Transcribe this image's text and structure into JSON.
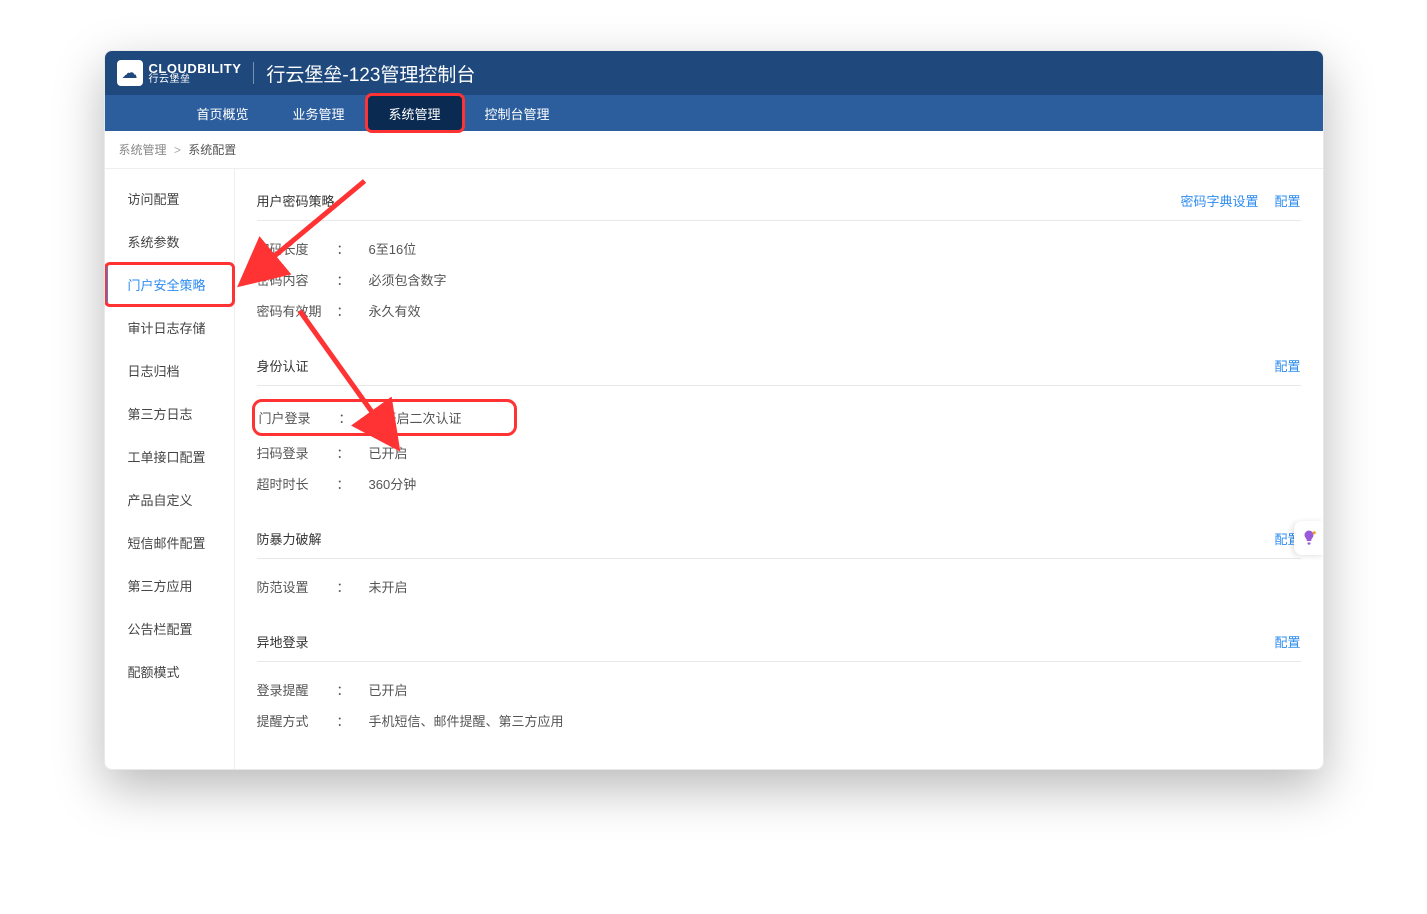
{
  "logo": {
    "main": "CLOUDBILITY",
    "sub": "行云堡垒"
  },
  "title": "行云堡垒-123管理控制台",
  "nav": [
    {
      "label": "首页概览",
      "active": false,
      "hl": false
    },
    {
      "label": "业务管理",
      "active": false,
      "hl": false
    },
    {
      "label": "系统管理",
      "active": true,
      "hl": true
    },
    {
      "label": "控制台管理",
      "active": false,
      "hl": false
    }
  ],
  "breadcrumb": {
    "root": "系统管理",
    "current": "系统配置"
  },
  "sidebar": [
    {
      "label": "访问配置",
      "active": false,
      "hl": false
    },
    {
      "label": "系统参数",
      "active": false,
      "hl": false
    },
    {
      "label": "门户安全策略",
      "active": true,
      "hl": true
    },
    {
      "label": "审计日志存储",
      "active": false,
      "hl": false
    },
    {
      "label": "日志归档",
      "active": false,
      "hl": false
    },
    {
      "label": "第三方日志",
      "active": false,
      "hl": false
    },
    {
      "label": "工单接口配置",
      "active": false,
      "hl": false
    },
    {
      "label": "产品自定义",
      "active": false,
      "hl": false
    },
    {
      "label": "短信邮件配置",
      "active": false,
      "hl": false
    },
    {
      "label": "第三方应用",
      "active": false,
      "hl": false
    },
    {
      "label": "公告栏配置",
      "active": false,
      "hl": false
    },
    {
      "label": "配额模式",
      "active": false,
      "hl": false
    }
  ],
  "sections": {
    "pwd": {
      "title": "用户密码策略",
      "links": [
        "密码字典设置",
        "配置"
      ],
      "rows": [
        {
          "k": "密码长度",
          "v": "6至16位"
        },
        {
          "k": "密码内容",
          "v": "必须包含数字"
        },
        {
          "k": "密码有效期",
          "v": "永久有效"
        }
      ]
    },
    "auth": {
      "title": "身份认证",
      "links": [
        "配置"
      ],
      "rows": [
        {
          "k": "门户登录",
          "v": "不开启二次认证",
          "hl": true
        },
        {
          "k": "扫码登录",
          "v": "已开启"
        },
        {
          "k": "超时时长",
          "v": "360分钟"
        }
      ]
    },
    "brute": {
      "title": "防暴力破解",
      "links": [
        "配置"
      ],
      "rows": [
        {
          "k": "防范设置",
          "v": "未开启"
        }
      ]
    },
    "remote": {
      "title": "异地登录",
      "links": [
        "配置"
      ],
      "rows": [
        {
          "k": "登录提醒",
          "v": "已开启"
        },
        {
          "k": "提醒方式",
          "v": "手机短信、邮件提醒、第三方应用"
        }
      ]
    }
  }
}
